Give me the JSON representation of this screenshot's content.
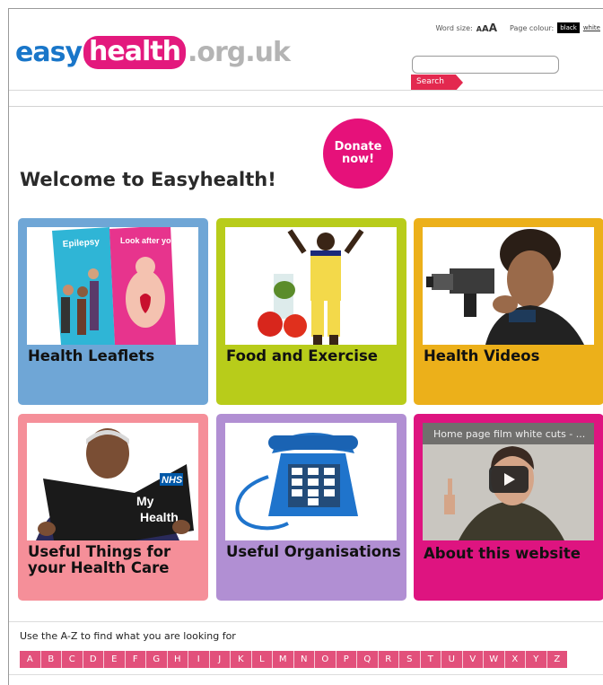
{
  "header": {
    "logo": {
      "part1": "easy",
      "part2": "health",
      "part3": ".org.uk"
    },
    "word_size_label": "Word size:",
    "page_colour_label": "Page colour:",
    "colour_black": "black",
    "colour_white": "white",
    "search": {
      "value": "",
      "button_label": "Search"
    }
  },
  "welcome_title": "Welcome to Easyhealth!",
  "donate_label": "Donate now!",
  "tiles": [
    {
      "label": "Health Leaflets",
      "color": "#6fa6d6",
      "leaflet_words": [
        "Epilepsy",
        "Look after your heart"
      ]
    },
    {
      "label": "Food and Exercise",
      "color": "#b8cc1a"
    },
    {
      "label": "Health Videos",
      "color": "#ecb01a"
    },
    {
      "label": "Useful Things for your Health Care",
      "color": "#f58f99",
      "book_text": [
        "My",
        "NHS",
        "Health"
      ]
    },
    {
      "label": "Useful Organisations",
      "color": "#b18fd3"
    },
    {
      "label": "About this website",
      "color": "#de1480",
      "video_title": "Home page film white cuts - ..."
    }
  ],
  "az": {
    "prompt": "Use the A-Z to find what you are looking for",
    "letters": [
      "A",
      "B",
      "C",
      "D",
      "E",
      "F",
      "G",
      "H",
      "I",
      "J",
      "K",
      "L",
      "M",
      "N",
      "O",
      "P",
      "Q",
      "R",
      "S",
      "T",
      "U",
      "V",
      "W",
      "X",
      "Y",
      "Z"
    ]
  },
  "colors": {
    "accent_pink": "#e3197d",
    "logo_blue": "#1976c9",
    "az_pink": "#e2507b"
  }
}
